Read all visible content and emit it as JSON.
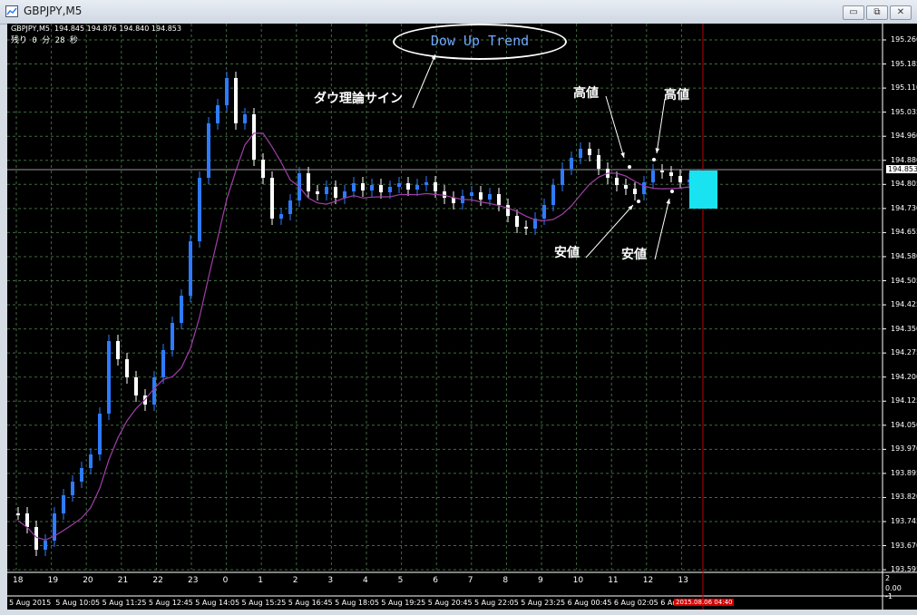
{
  "window": {
    "title": "GBPJPY,M5",
    "buttons": {
      "minimize": "▭",
      "restore": "⧉",
      "close": "✕"
    }
  },
  "chart_header": {
    "symbol_line": "GBPJPY,M5  194.845 194.876 194.840 194.853",
    "countdown": "残り 0 分 28 秒"
  },
  "annotations": {
    "trend_label": "Dow Up Trend",
    "dow_sign": "ダウ理論サイン",
    "high_1": "高値",
    "high_2": "高値",
    "low_1": "安値",
    "low_2": "安値"
  },
  "price_axis": [
    "195.260",
    "195.185",
    "195.110",
    "195.035",
    "194.960",
    "194.880",
    "194.805",
    "194.730",
    "194.655",
    "194.580",
    "194.505",
    "194.425",
    "194.350",
    "194.275",
    "194.200",
    "194.125",
    "194.050",
    "193.970",
    "193.895",
    "193.820",
    "193.745",
    "193.670",
    "193.595"
  ],
  "current_price": "194.853",
  "hour_labels": [
    "18",
    "19",
    "20",
    "21",
    "22",
    "23",
    "0",
    "1",
    "2",
    "3",
    "4",
    "5",
    "6",
    "7",
    "8",
    "9",
    "10",
    "11",
    "12",
    "13"
  ],
  "time_labels": [
    "5 Aug 2015",
    "5 Aug 10:05",
    "5 Aug 11:25",
    "5 Aug 12:45",
    "5 Aug 14:05",
    "5 Aug 15:25",
    "5 Aug 16:45",
    "5 Aug 18:05",
    "5 Aug 19:25",
    "5 Aug 20:45",
    "5 Aug 22:05",
    "5 Aug 23:25",
    "6 Aug 00:45",
    "6 Aug 02:05",
    "6 Au"
  ],
  "time_cursor_label": "2015.08.06 04:40",
  "sub_window_axis": [
    "2",
    "0.00",
    "-1"
  ],
  "colors": {
    "background": "#000000",
    "candle": "#2e7bff",
    "candle_light": "#ffffff",
    "ma_line": "#a03fa8",
    "grid": "#3f6b3f",
    "cursor_line": "#c00000",
    "box_highlight": "#19e3f0",
    "trend_text": "#6fa8ff"
  }
}
